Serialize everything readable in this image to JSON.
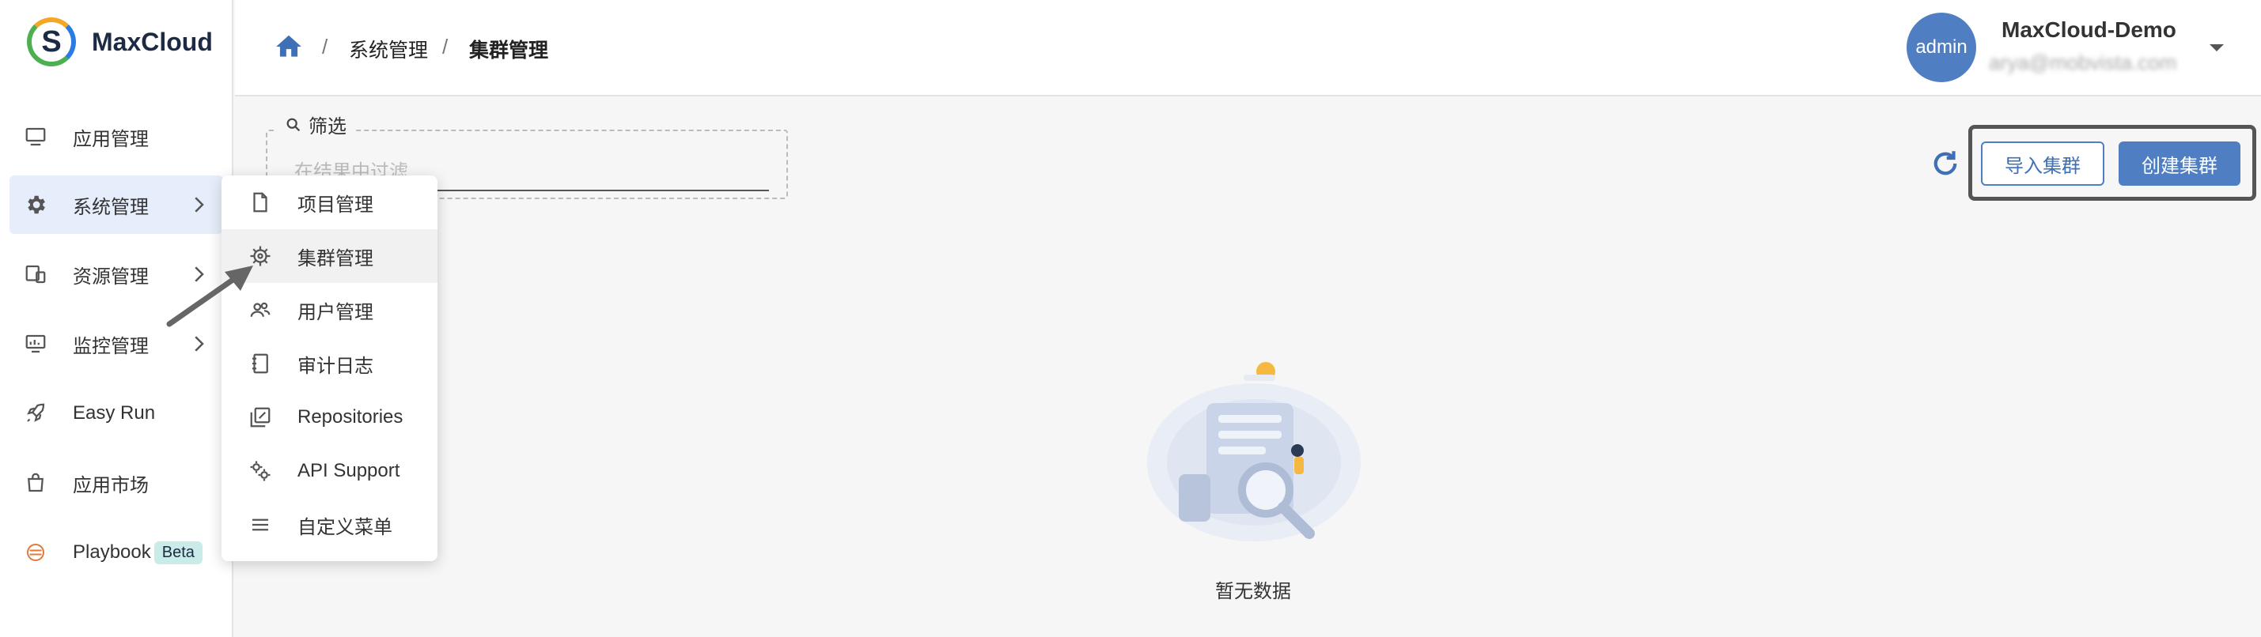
{
  "brand": {
    "name": "MaxCloud",
    "logo_letter": "S"
  },
  "sidebar": {
    "items": [
      {
        "label": "应用管理",
        "icon": "monitor-icon"
      },
      {
        "label": "系统管理",
        "icon": "gear-icon",
        "active": true
      },
      {
        "label": "资源管理",
        "icon": "devices-icon"
      },
      {
        "label": "监控管理",
        "icon": "dashboard-icon"
      },
      {
        "label": "Easy Run",
        "icon": "rocket-icon"
      },
      {
        "label": "应用市场",
        "icon": "shopping-bag-icon"
      },
      {
        "label": "Playbook",
        "icon": "playbook-icon",
        "badge": "Beta"
      }
    ]
  },
  "breadcrumb": {
    "sep1": "/",
    "item1": "系统管理",
    "sep2": "/",
    "item2": "集群管理"
  },
  "user": {
    "avatar_text": "admin",
    "name": "MaxCloud-Demo",
    "email": "arya@mobvista.com"
  },
  "filter": {
    "legend": "筛选",
    "placeholder": "在结果中过滤"
  },
  "actions": {
    "import_label": "导入集群",
    "create_label": "创建集群"
  },
  "empty": {
    "text": "暂无数据"
  },
  "submenu": {
    "items": [
      {
        "label": "项目管理",
        "icon": "document-icon"
      },
      {
        "label": "集群管理",
        "icon": "helm-wheel-icon",
        "hover": true
      },
      {
        "label": "用户管理",
        "icon": "users-icon"
      },
      {
        "label": "审计日志",
        "icon": "notebook-icon"
      },
      {
        "label": "Repositories",
        "icon": "library-icon"
      },
      {
        "label": "API Support",
        "icon": "cogs-icon"
      },
      {
        "label": "自定义菜单",
        "icon": "menu-lines-icon"
      }
    ]
  },
  "colors": {
    "accent": "#4f7fc2",
    "active_bg": "#e7eefb",
    "badge_bg": "#c9ece8"
  }
}
